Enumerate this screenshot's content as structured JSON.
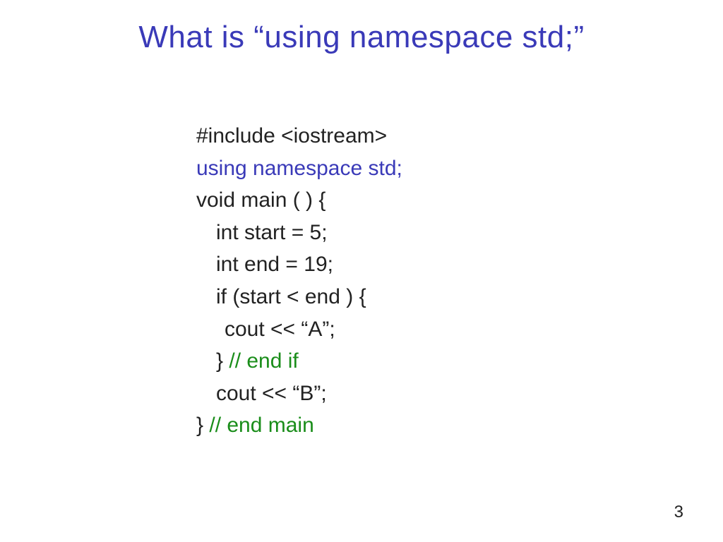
{
  "slide": {
    "title": "What is “using namespace std;”",
    "page_number": "3"
  },
  "code": {
    "line1": "#include <iostream>",
    "line2": "using namespace std;",
    "line3": "void main ( ) {",
    "line4": "int start = 5;",
    "line5": "int end = 19;",
    "line6": "if (start < end ) {",
    "line7": "cout << “A”;",
    "line8_a": "} ",
    "line8_b": "// end if",
    "line9": "cout << “B”;",
    "line10_a": "} ",
    "line10_b": "// end main"
  }
}
